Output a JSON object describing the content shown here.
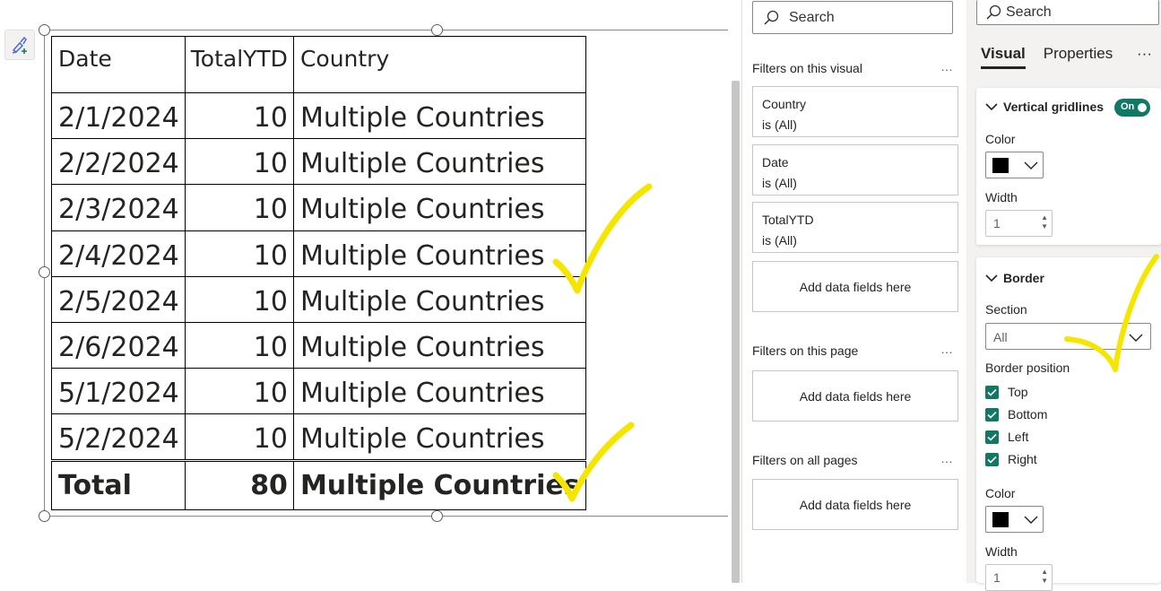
{
  "table": {
    "headers": [
      "Date",
      "TotalYTD",
      "Country"
    ],
    "rows": [
      {
        "date": "2/1/2024",
        "total": "10",
        "country": "Multiple Countries"
      },
      {
        "date": "2/2/2024",
        "total": "10",
        "country": "Multiple Countries"
      },
      {
        "date": "2/3/2024",
        "total": "10",
        "country": "Multiple Countries"
      },
      {
        "date": "2/4/2024",
        "total": "10",
        "country": "Multiple Countries"
      },
      {
        "date": "2/5/2024",
        "total": "10",
        "country": "Multiple Countries"
      },
      {
        "date": "2/6/2024",
        "total": "10",
        "country": "Multiple Countries"
      },
      {
        "date": "5/1/2024",
        "total": "10",
        "country": "Multiple Countries"
      },
      {
        "date": "5/2/2024",
        "total": "10",
        "country": "Multiple Countries"
      }
    ],
    "total": {
      "date": "Total",
      "total": "80",
      "country": "Multiple Countries"
    }
  },
  "filters": {
    "search_label": "Search",
    "visual_section": "Filters on this visual",
    "page_section": "Filters on this page",
    "all_section": "Filters on all pages",
    "more": "…",
    "cards": [
      {
        "field": "Country",
        "state": "is (All)"
      },
      {
        "field": "Date",
        "state": "is (All)"
      },
      {
        "field": "TotalYTD",
        "state": "is (All)"
      }
    ],
    "add_label": "Add data fields here"
  },
  "format": {
    "search_label": "Search",
    "tab_visual": "Visual",
    "tab_properties": "Properties",
    "more": "···",
    "gridlines": {
      "title": "Vertical gridlines",
      "toggle": "On",
      "color_label": "Color",
      "width_label": "Width",
      "width_value": "1"
    },
    "border": {
      "title": "Border",
      "section_label": "Section",
      "section_value": "All",
      "position_label": "Border position",
      "positions": [
        "Top",
        "Bottom",
        "Left",
        "Right"
      ],
      "color_label": "Color",
      "width_label": "Width",
      "width_value": "1"
    }
  },
  "colors": {
    "accent": "#117865",
    "annotation": "#f5e600"
  },
  "icons": [
    "paintbrush-plus-icon",
    "search-icon",
    "chevron-down-icon",
    "checkmark-icon",
    "spin-arrows-icon"
  ]
}
